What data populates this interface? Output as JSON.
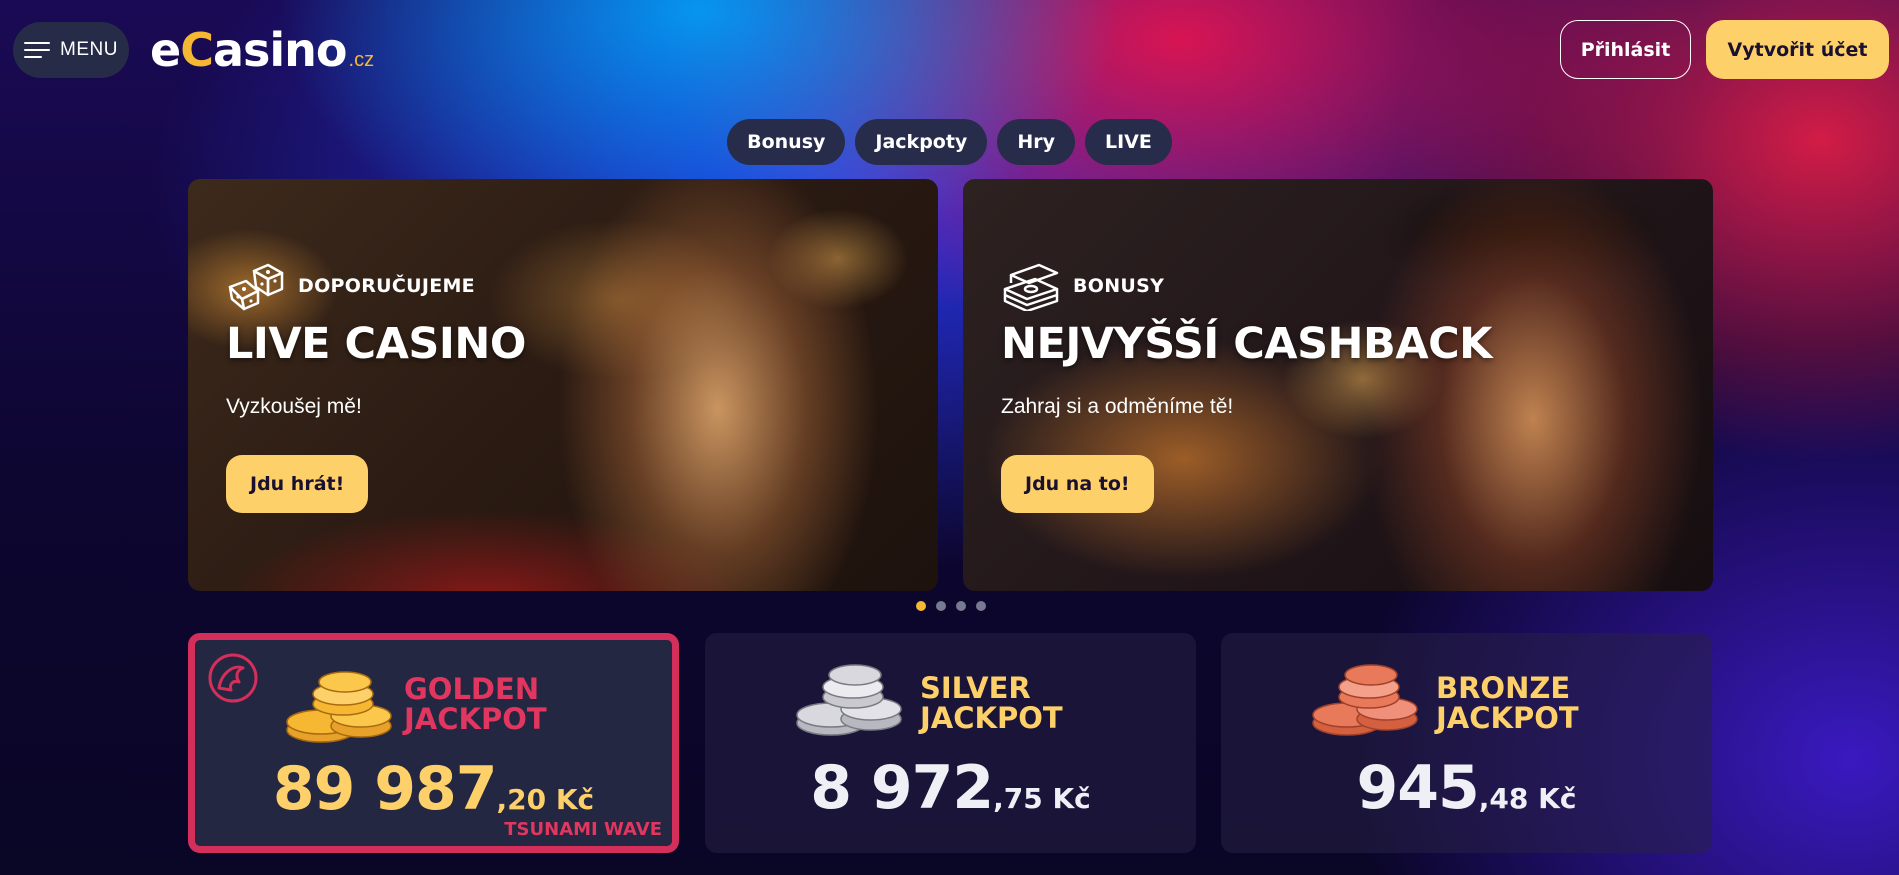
{
  "header": {
    "menu_label": "MENU",
    "logo": {
      "e": "e",
      "c": "C",
      "rest": "asino",
      "tld": ".cz"
    },
    "login_label": "Přihlásit",
    "register_label": "Vytvořit účet"
  },
  "nav": {
    "pills": [
      "Bonusy",
      "Jackpoty",
      "Hry",
      "LIVE"
    ]
  },
  "banners": [
    {
      "tag": "DOPORUČUJEME",
      "icon": "dice-icon",
      "title": "LIVE CASINO",
      "subtitle": "Vyzkoušej mě!",
      "cta": "Jdu hrát!"
    },
    {
      "tag": "BONUSY",
      "icon": "money-stack-icon",
      "title": "NEJVYŠŠÍ CASHBACK",
      "subtitle": "Zahraj si a odměníme tě!",
      "cta": "Jdu na to!"
    }
  ],
  "carousel": {
    "count": 4,
    "active": 1
  },
  "jackpots": [
    {
      "name_line1": "GOLDEN",
      "name_line2": "JACKPOT",
      "amount_int": "89 987",
      "amount_dec": ",20 Kč",
      "badge": "TSUNAMI WAVE",
      "coin_color": "#f6b733"
    },
    {
      "name_line1": "SILVER",
      "name_line2": "JACKPOT",
      "amount_int": "8 972",
      "amount_dec": ",75 Kč",
      "coin_color": "#c9c9cf"
    },
    {
      "name_line1": "BRONZE",
      "name_line2": "JACKPOT",
      "amount_int": "945",
      "amount_dec": ",48 Kč",
      "coin_color": "#e8795a"
    }
  ],
  "colors": {
    "accent": "#fdd06a",
    "gold_border": "#d42f5b",
    "gold_text": "#e0365f"
  }
}
